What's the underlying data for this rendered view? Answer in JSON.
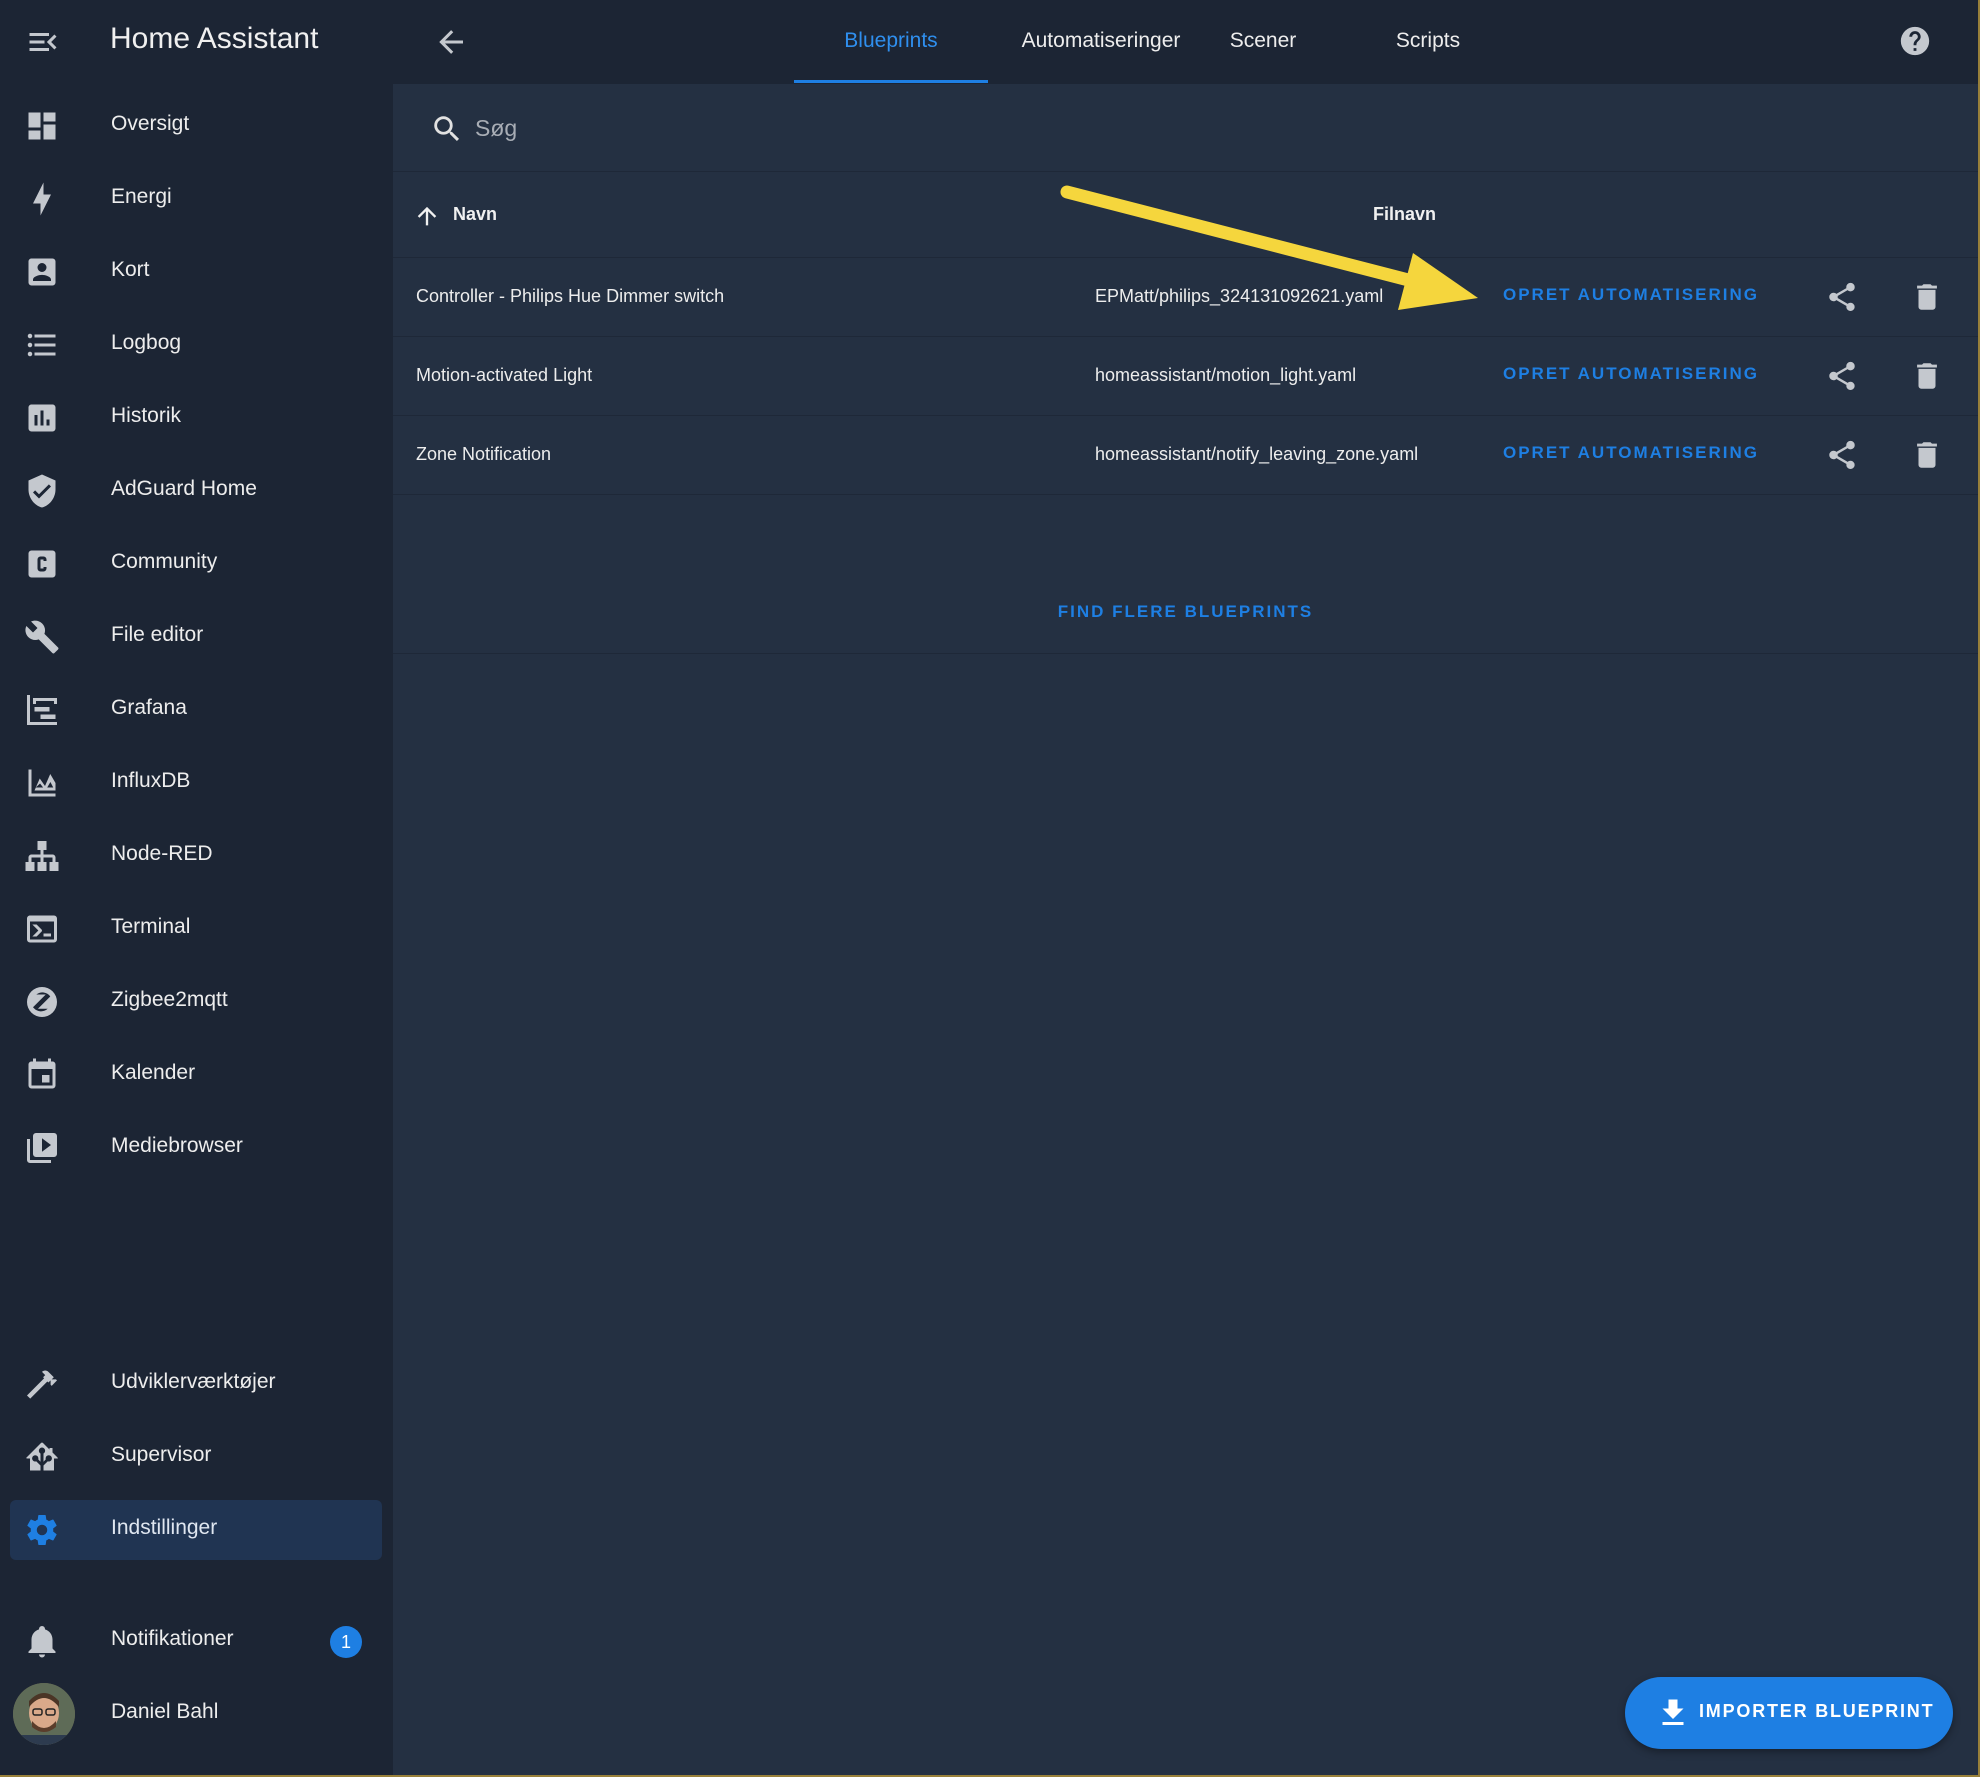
{
  "app": {
    "title": "Home Assistant"
  },
  "sidebar": {
    "items": [
      {
        "label": "Oversigt",
        "icon": "view-dashboard-icon"
      },
      {
        "label": "Energi",
        "icon": "lightning-bolt-icon"
      },
      {
        "label": "Kort",
        "icon": "account-box-icon"
      },
      {
        "label": "Logbog",
        "icon": "format-list-bulleted-icon"
      },
      {
        "label": "Historik",
        "icon": "chart-box-icon"
      },
      {
        "label": "AdGuard Home",
        "icon": "shield-check-icon"
      },
      {
        "label": "Community",
        "icon": "alpha-c-box-icon"
      },
      {
        "label": "File editor",
        "icon": "wrench-icon"
      },
      {
        "label": "Grafana",
        "icon": "chart-timeline-icon"
      },
      {
        "label": "InfluxDB",
        "icon": "chart-areaspline-icon"
      },
      {
        "label": "Node-RED",
        "icon": "sitemap-icon"
      },
      {
        "label": "Terminal",
        "icon": "console-icon"
      },
      {
        "label": "Zigbee2mqtt",
        "icon": "zigbee-icon"
      },
      {
        "label": "Kalender",
        "icon": "calendar-icon"
      },
      {
        "label": "Mediebrowser",
        "icon": "play-box-multiple-icon"
      }
    ],
    "bottom_items": [
      {
        "label": "Udviklerværktøjer",
        "icon": "hammer-icon"
      },
      {
        "label": "Supervisor",
        "icon": "home-assistant-icon"
      },
      {
        "label": "Indstillinger",
        "icon": "cog-icon"
      }
    ],
    "notifications": {
      "label": "Notifikationer",
      "count": "1"
    },
    "user": {
      "name": "Daniel Bahl"
    },
    "active": "Indstillinger"
  },
  "topbar": {
    "tabs": [
      "Blueprints",
      "Automatiseringer",
      "Scener",
      "Scripts"
    ],
    "active_tab": "Blueprints"
  },
  "search": {
    "placeholder": "Søg"
  },
  "table": {
    "columns": {
      "name": "Navn",
      "filename": "Filnavn"
    },
    "rows": [
      {
        "name": "Controller - Philips Hue Dimmer switch",
        "filename": "EPMatt/philips_324131092621.yaml",
        "action": "OPRET AUTOMATISERING"
      },
      {
        "name": "Motion-activated Light",
        "filename": "homeassistant/motion_light.yaml",
        "action": "OPRET AUTOMATISERING"
      },
      {
        "name": "Zone Notification",
        "filename": "homeassistant/notify_leaving_zone.yaml",
        "action": "OPRET AUTOMATISERING"
      }
    ],
    "find_more": "FIND FLERE BLUEPRINTS"
  },
  "fab": {
    "label": "IMPORTER BLUEPRINT"
  },
  "colors": {
    "accent": "#1e7fe3",
    "sidebar_bg": "#1c2534",
    "content_bg": "#243042",
    "annotation_arrow": "#f5d63d"
  }
}
